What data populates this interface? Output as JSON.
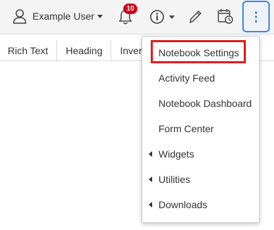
{
  "topbar": {
    "user_name": "Example User",
    "notification_count": "10",
    "icons": [
      "user-icon",
      "bell-icon",
      "info-icon",
      "pen-icon",
      "calendar-clock-icon",
      "kebab-menu-icon"
    ],
    "kebab_symbol": "⋮",
    "accent_color": "#3a86e8",
    "badge_color": "#d0021b"
  },
  "tabs": [
    "Rich Text",
    "Heading",
    "Inver"
  ],
  "dropdown": {
    "items": [
      {
        "label": "Notebook Settings",
        "submenu": false
      },
      {
        "label": "Activity Feed",
        "submenu": false
      },
      {
        "label": "Notebook Dashboard",
        "submenu": false
      },
      {
        "label": "Form Center",
        "submenu": false
      },
      {
        "label": "Widgets",
        "submenu": true
      },
      {
        "label": "Utilities",
        "submenu": true
      },
      {
        "label": "Downloads",
        "submenu": true
      }
    ],
    "highlight_color": "#e01c1c"
  }
}
